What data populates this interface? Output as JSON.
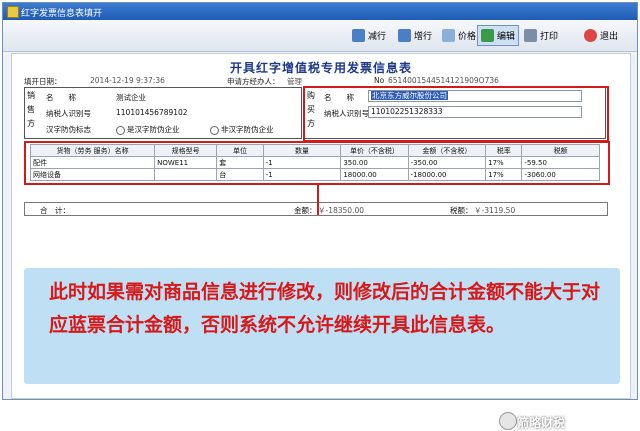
{
  "window": {
    "title": "红字发票信息表填开"
  },
  "toolbar": {
    "tax_reduce": "减行",
    "add_row": "增行",
    "price": "价格",
    "edit": "编辑",
    "print": "打印",
    "exit": "退出"
  },
  "form": {
    "title": "开具红字增值税专用发票信息表",
    "date_label": "填开日期：",
    "date_value": "2014-12-19 9:37:36",
    "operator_label": "申请方经办人：",
    "operator_value": "管理",
    "no_label": "No",
    "no_value": "6514001544514121909O736"
  },
  "seller": {
    "vertical": [
      "销",
      "售",
      "方"
    ],
    "name_label": "名　　称",
    "name_value": "测试企业",
    "taxid_label": "纳税人识别号",
    "taxid_value": "110101456789102",
    "anticounterfeit_label": "汉字防伪标志",
    "opt_yes": "是汉字防伪企业",
    "opt_no": "非汉字防伪企业"
  },
  "buyer": {
    "vertical": [
      "购",
      "买",
      "方"
    ],
    "name_label": "名　　称",
    "name_value": "北京东方威尔股份公司",
    "taxid_label": "纳税人识别号",
    "taxid_value": "110102251328333"
  },
  "goods": {
    "headers": [
      "货物（劳务 服务）名称",
      "规格型号",
      "单位",
      "数量",
      "单价（不含税）",
      "金额（不含税）",
      "税率",
      "税额"
    ],
    "rows": [
      [
        "配件",
        "NOWE11",
        "套",
        "-1",
        "350.00",
        "-350.00",
        "17%",
        "-59.50"
      ],
      [
        "网络设备",
        "",
        "台",
        "-1",
        "18000.00",
        "-18000.00",
        "17%",
        "-3060.00"
      ]
    ]
  },
  "totals": {
    "label": "合　计：",
    "amount_label": "金额：",
    "amount_value": "￥-18350.00",
    "tax_label": "税额：",
    "tax_value": "￥-3119.50"
  },
  "callout": {
    "text": "此时如果需对商品信息进行修改，则修改后的合计金额不能大于对应蓝票合计金额，否则系统不允许继续开具此信息表。"
  },
  "watermark": {
    "text": "箭略财税"
  },
  "colors": {
    "accent_red": "#d81818",
    "callout_bg": "#bfe0f4",
    "title_blue": "#1d3a8a"
  }
}
